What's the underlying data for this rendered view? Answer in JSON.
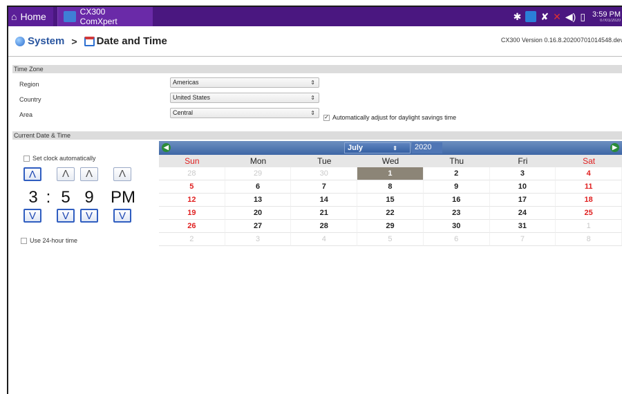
{
  "topbar": {
    "home_label": "Home",
    "app_tab_label": "CX300 ComXpert",
    "clock_time": "3:59 PM",
    "clock_date": "07/01/2020"
  },
  "header": {
    "crumb_system": "System",
    "crumb_separator": ">",
    "crumb_current": "Date and Time",
    "version": "CX300 Version 0.16.8.20200701014548.dev"
  },
  "timezone": {
    "section_title": "Time Zone",
    "region_label": "Region",
    "region_value": "Americas",
    "country_label": "Country",
    "country_value": "United States",
    "area_label": "Area",
    "area_value": "Central",
    "dst_label": "Automatically adjust for daylight savings time",
    "dst_checked": true
  },
  "datetime": {
    "section_title": "Current Date & Time",
    "auto_clock_label": "Set clock automatically",
    "use24_label": "Use 24-hour time",
    "hour": "3",
    "colon": ":",
    "minute_tens": "5",
    "minute_ones": "9",
    "ampm": "PM",
    "up_glyph": "Λ",
    "down_glyph": "V"
  },
  "calendar": {
    "month": "July",
    "year": "2020",
    "weekdays": [
      "Sun",
      "Mon",
      "Tue",
      "Wed",
      "Thu",
      "Fri",
      "Sat"
    ],
    "weeks": [
      [
        "28",
        "29",
        "30",
        "1",
        "2",
        "3",
        "4"
      ],
      [
        "5",
        "6",
        "7",
        "8",
        "9",
        "10",
        "11"
      ],
      [
        "12",
        "13",
        "14",
        "15",
        "16",
        "17",
        "18"
      ],
      [
        "19",
        "20",
        "21",
        "22",
        "23",
        "24",
        "25"
      ],
      [
        "26",
        "27",
        "28",
        "29",
        "30",
        "31",
        "1"
      ],
      [
        "2",
        "3",
        "4",
        "5",
        "6",
        "7",
        "8"
      ]
    ],
    "selected_day": "1"
  },
  "colors": {
    "topbar": "#4a1780",
    "accent_blue": "#2049b3",
    "weekend_red": "#e02020",
    "today_bg": "#8c8577"
  }
}
